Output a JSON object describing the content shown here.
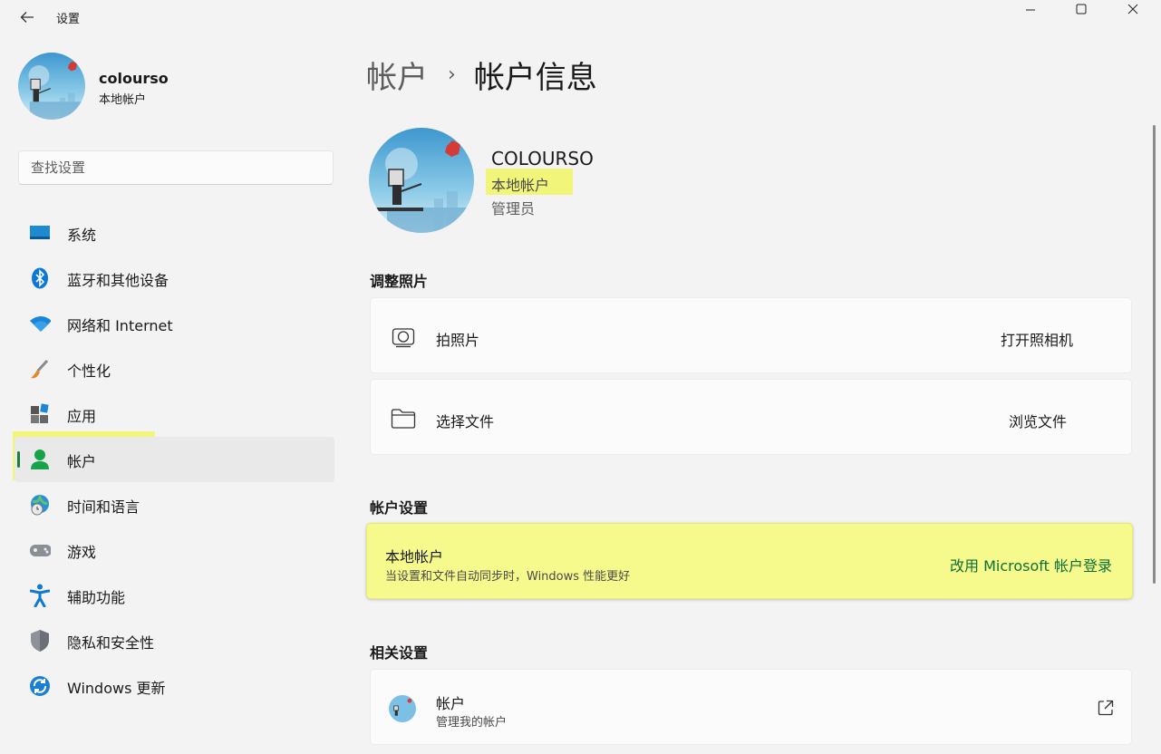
{
  "window": {
    "title": "设置"
  },
  "profile": {
    "name": "colourso",
    "account_type": "本地帐户"
  },
  "search": {
    "placeholder": "查找设置"
  },
  "nav": [
    {
      "label": "系统",
      "icon": "monitor-icon"
    },
    {
      "label": "蓝牙和其他设备",
      "icon": "bluetooth-icon"
    },
    {
      "label": "网络和 Internet",
      "icon": "wifi-icon"
    },
    {
      "label": "个性化",
      "icon": "brush-icon"
    },
    {
      "label": "应用",
      "icon": "apps-icon"
    },
    {
      "label": "帐户",
      "icon": "person-icon",
      "selected": true
    },
    {
      "label": "时间和语言",
      "icon": "globe-clock-icon"
    },
    {
      "label": "游戏",
      "icon": "gamepad-icon"
    },
    {
      "label": "辅助功能",
      "icon": "accessibility-icon"
    },
    {
      "label": "隐私和安全性",
      "icon": "shield-icon"
    },
    {
      "label": "Windows 更新",
      "icon": "update-icon"
    }
  ],
  "breadcrumb": {
    "parent": "帐户",
    "separator": "›",
    "current": "帐户信息"
  },
  "user": {
    "name": "COLOURSO",
    "type": "本地帐户",
    "role": "管理员"
  },
  "adjust_photo": {
    "title": "调整照片",
    "take_photo": {
      "label": "拍照片",
      "action": "打开照相机",
      "icon": "camera-icon"
    },
    "choose_file": {
      "label": "选择文件",
      "action": "浏览文件",
      "icon": "folder-icon"
    }
  },
  "account_settings": {
    "title": "帐户设置",
    "local": {
      "label": "本地帐户",
      "description": "当设置和文件自动同步时，Windows 性能更好",
      "link": "改用 Microsoft 帐户登录"
    }
  },
  "related": {
    "title": "相关设置",
    "accounts": {
      "label": "帐户",
      "description": "管理我的帐户",
      "icon": "external-link-icon"
    }
  },
  "colors": {
    "accent": "#1a7f37",
    "link": "#0e6f36",
    "highlight": "#f0f650"
  }
}
